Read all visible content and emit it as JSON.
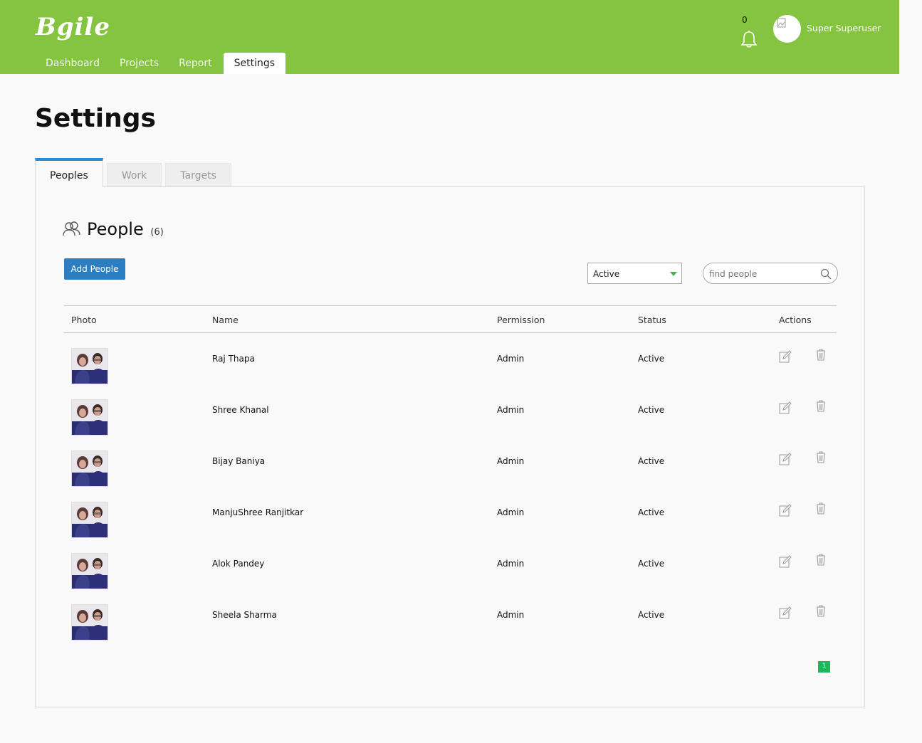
{
  "header": {
    "logo_text": "Bgile",
    "nav": [
      {
        "label": "Dashboard"
      },
      {
        "label": "Projects"
      },
      {
        "label": "Report"
      },
      {
        "label": "Settings"
      }
    ],
    "active_nav": "Settings",
    "notification_count": "0",
    "user_name": "Super Superuser",
    "bar_color": "#84c441"
  },
  "page": {
    "title": "Settings",
    "tabs": [
      {
        "label": "Peoples"
      },
      {
        "label": "Work"
      },
      {
        "label": "Targets"
      }
    ],
    "active_tab": "Peoples"
  },
  "people": {
    "heading": "People",
    "count": "(6)",
    "add_button": "Add People",
    "status_filter": "Active",
    "search_placeholder": "find people",
    "columns": {
      "photo": "Photo",
      "name": "Name",
      "permission": "Permission",
      "status": "Status",
      "actions": "Actions"
    },
    "rows": [
      {
        "name": "Raj Thapa",
        "permission": "Admin",
        "status": "Active"
      },
      {
        "name": "Shree Khanal",
        "permission": "Admin",
        "status": "Active"
      },
      {
        "name": "Bijay Baniya",
        "permission": "Admin",
        "status": "Active"
      },
      {
        "name": "ManjuShree Ranjitkar",
        "permission": "Admin",
        "status": "Active"
      },
      {
        "name": "Alok Pandey",
        "permission": "Admin",
        "status": "Active"
      },
      {
        "name": "Sheela Sharma",
        "permission": "Admin",
        "status": "Active"
      }
    ],
    "pagination": [
      "1"
    ]
  },
  "icons": {
    "notifications": "bell-icon",
    "user_avatar": "broken-image-icon",
    "people": "people-icon",
    "search": "search-icon",
    "edit": "edit-icon",
    "delete": "trash-icon"
  }
}
